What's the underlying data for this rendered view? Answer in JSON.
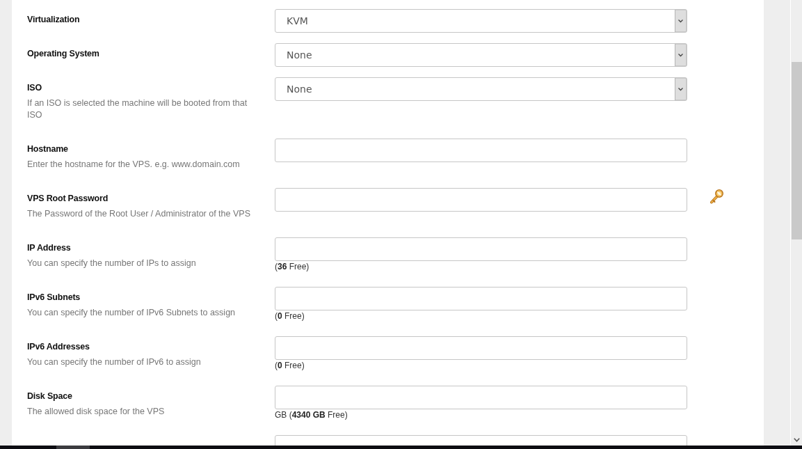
{
  "fields": [
    {
      "kind": "select",
      "label": "Virtualization",
      "value": "KVM"
    },
    {
      "kind": "select",
      "label": "Operating System",
      "value": "None"
    },
    {
      "kind": "select",
      "label": "ISO",
      "description": "If an ISO is selected the machine will be booted from that ISO",
      "value": "None"
    },
    {
      "kind": "text",
      "label": "Hostname",
      "description": "Enter the hostname for the VPS. e.g. www.domain.com"
    },
    {
      "kind": "password",
      "label": "VPS Root Password",
      "description": "The Password of the Root User / Administrator of the VPS"
    },
    {
      "kind": "text",
      "label": "IP Address",
      "description": "You can specify the number of IPs to assign",
      "note": "(**36** Free)"
    },
    {
      "kind": "text",
      "label": "IPv6 Subnets",
      "description": "You can specify the number of IPv6 Subnets to assign",
      "note": "(**0** Free)"
    },
    {
      "kind": "text",
      "label": "IPv6 Addresses",
      "description": "You can specify the number of IPv6 to assign",
      "note": "(**0** Free)"
    },
    {
      "kind": "text",
      "label": "Disk Space",
      "description": "The allowed disk space for the VPS",
      "note": "GB (**4340 GB** Free)"
    },
    {
      "kind": "text"
    }
  ]
}
